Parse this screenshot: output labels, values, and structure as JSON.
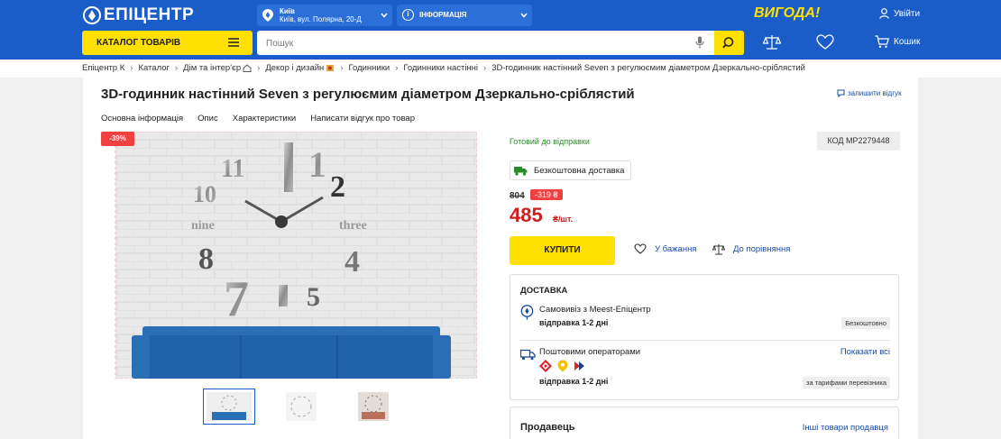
{
  "header": {
    "logo": "ЕПІЦЕНТР",
    "location": {
      "city": "Київ",
      "address": "Київ, вул. Полярна, 20-Д"
    },
    "info_label": "ІНФОРМАЦІЯ",
    "promo": "ВИГОДА!",
    "login_label": "Увійти",
    "catalog_label": "КАТАЛОГ ТОВАРІВ",
    "search_placeholder": "Пошук",
    "cart_label": "Кошик"
  },
  "breadcrumbs": [
    "Епіцентр К",
    "Каталог",
    "Дім та інтер'єр",
    "Декор і дизайн",
    "Годинники",
    "Годинники настінні",
    "3D-годинник настінний Seven з регулюємим діаметром Дзеркально-сріблястий"
  ],
  "product": {
    "title": "3D-годинник настінний Seven з регулюємим діаметром Дзеркально-сріблястий",
    "review_link": "залишити відгук",
    "tabs": [
      "Основна інформація",
      "Опис",
      "Характеристики",
      "Написати відгук про товар"
    ],
    "discount_badge": "-39%",
    "image_numbers": {
      "n11": "11",
      "n1": "1",
      "n2": "2",
      "n10": "10",
      "nine": "nine",
      "three": "three",
      "n8": "8",
      "n4": "4",
      "n7": "7",
      "n5": "5"
    },
    "status": "Готовий до відправки",
    "code": "КОД MP2279448",
    "free_shipping": "Безкоштовна доставка",
    "old_price": "804",
    "discount_amount": "-319 ₴",
    "price": "485",
    "unit": "₴/шт.",
    "buy_label": "КУПИТИ",
    "wishlist_label": "У бажання",
    "compare_label": "До порівняння"
  },
  "delivery": {
    "heading": "ДОСТАВКА",
    "options": [
      {
        "name": "Самовивіз з Meest-Епіцентр",
        "time": "відправка 1-2 дні",
        "tag": "Безкоштовно"
      },
      {
        "name": "Поштовими операторами",
        "time": "відправка 1-2 дні",
        "tag": "за тарифами перевізника",
        "link": "Показати всі"
      }
    ]
  },
  "seller": {
    "heading": "Продавець",
    "link": "Інші товари продавця"
  },
  "colors": {
    "header_blue": "#1a5cc8",
    "accent_yellow": "#ffe000",
    "price_red": "#d11c1c",
    "link_blue": "#1a4ca8"
  }
}
